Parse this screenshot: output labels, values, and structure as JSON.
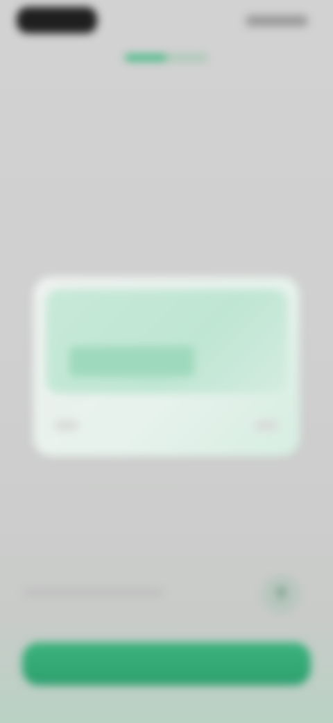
{
  "status": {
    "time": "",
    "right": ""
  },
  "onboarding": {
    "progress": 0.5
  },
  "header": {
    "title": "",
    "subtitle": ""
  },
  "card": {
    "heading": "",
    "amount": "",
    "amount_side": "",
    "action_left": "",
    "action_right": ""
  },
  "footer": {
    "text": ""
  },
  "cta": {
    "label": ""
  },
  "colors": {
    "accent": "#3bb27d",
    "card_tint": "#c7e9d8"
  },
  "icons": {
    "help": "help-icon"
  }
}
